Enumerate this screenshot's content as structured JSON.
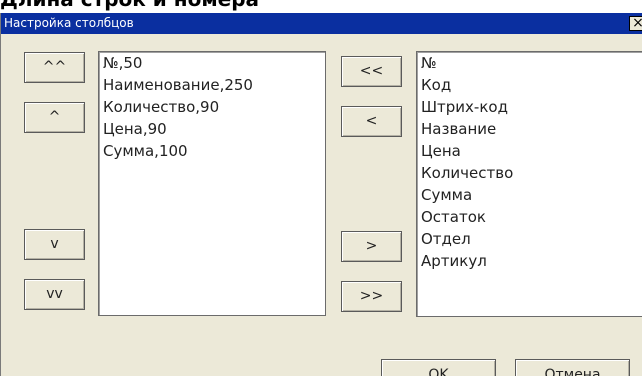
{
  "top_strip_text": "Длина строк и номера",
  "dialog": {
    "title": "Настройка столбцов",
    "close_glyph": "×"
  },
  "left_buttons": {
    "move_top": "^^",
    "move_up": "^",
    "move_down": "v",
    "move_bottom": "vv"
  },
  "selected_columns": [
    "№,50",
    "Наименование,250",
    "Количество,90",
    "Цена,90",
    "Сумма,100"
  ],
  "transfer_buttons": {
    "add_all": "<<",
    "add_one": "<",
    "remove_one": ">",
    "remove_all": ">>"
  },
  "available_columns": [
    "№",
    "Код",
    "Штрих-код",
    "Название",
    "Цена",
    "Количество",
    "Сумма",
    "Остаток",
    "Отдел",
    "Артикул"
  ],
  "footer": {
    "ok_label": "OK",
    "cancel_label": "Отмена"
  }
}
